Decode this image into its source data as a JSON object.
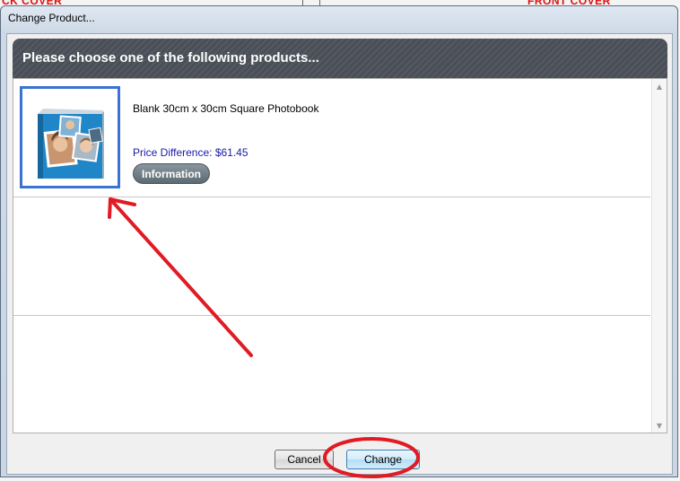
{
  "background": {
    "left_label": "CK COVER",
    "right_label": "FRONT COVER"
  },
  "dialog": {
    "title": "Change Product...",
    "banner": "Please choose one of the following products...",
    "products": [
      {
        "name": "Blank 30cm x 30cm Square Photobook",
        "price_difference": "Price Difference: $61.45",
        "info_label": "Information"
      }
    ],
    "cancel_label": "Cancel",
    "change_label": "Change"
  },
  "colors": {
    "annotation_red": "#e01b24",
    "thumb_border": "#3a73d4",
    "banner_bg": "#4a4f57",
    "price_text": "#1a1aa6"
  }
}
